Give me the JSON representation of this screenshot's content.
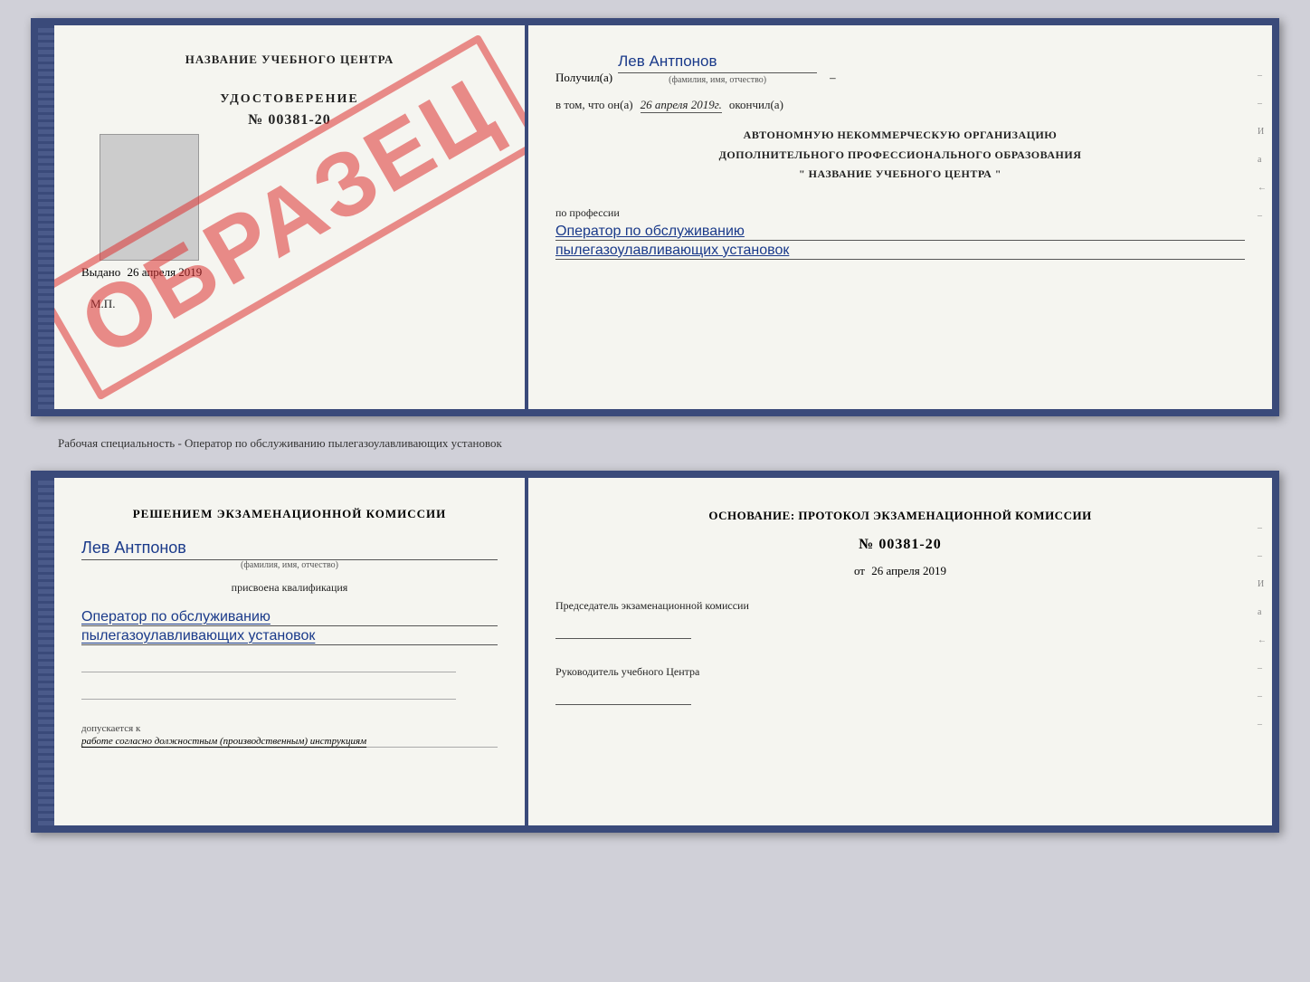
{
  "top_document": {
    "left": {
      "title": "НАЗВАНИЕ УЧЕБНОГО ЦЕНТРА",
      "cert_type": "УДОСТОВЕРЕНИЕ",
      "cert_number": "№ 00381-20",
      "watermark": "ОБРАЗЕЦ",
      "issued_label": "Выдано",
      "issued_date": "26 апреля 2019",
      "mp_label": "М.П."
    },
    "right": {
      "received_label": "Получил(а)",
      "recipient_name": "Лев Антпонов",
      "fio_sublabel": "(фамилия, имя, отчество)",
      "dash": "–",
      "in_that_label": "в том, что он(а)",
      "completed_date": "26 апреля 2019г.",
      "completed_label": "окончил(а)",
      "org_line1": "АВТОНОМНУЮ НЕКОММЕРЧЕСКУЮ ОРГАНИЗАЦИЮ",
      "org_line2": "ДОПОЛНИТЕЛЬНОГО ПРОФЕССИОНАЛЬНОГО ОБРАЗОВАНИЯ",
      "org_name": "\" НАЗВАНИЕ УЧЕБНОГО ЦЕНТРА \"",
      "profession_label": "по профессии",
      "profession_line1": "Оператор по обслуживанию",
      "profession_line2": "пылегазоулавливающих установок"
    }
  },
  "separator": {
    "text": "Рабочая специальность - Оператор по обслуживанию пылегазоулавливающих установок"
  },
  "bottom_document": {
    "left": {
      "decision_label": "Решением экзаменационной комиссии",
      "person_name": "Лев Антпонов",
      "fio_sublabel": "(фамилия, имя, отчество)",
      "assigned_label": "присвоена квалификация",
      "qualification_line1": "Оператор по обслуживанию",
      "qualification_line2": "пылегазоулавливающих установок",
      "allowed_prefix": "допускается к",
      "allowed_work": "работе согласно должностным (производственным) инструкциям"
    },
    "right": {
      "basis_label": "Основание: протокол экзаменационной комиссии",
      "protocol_number": "№ 00381-20",
      "protocol_date_prefix": "от",
      "protocol_date": "26 апреля 2019",
      "chairman_label": "Председатель экзаменационной комиссии",
      "director_label": "Руководитель учебного Центра"
    }
  },
  "side_marks": [
    "–",
    "–",
    "И",
    "а",
    "←",
    "–",
    "–",
    "–"
  ]
}
